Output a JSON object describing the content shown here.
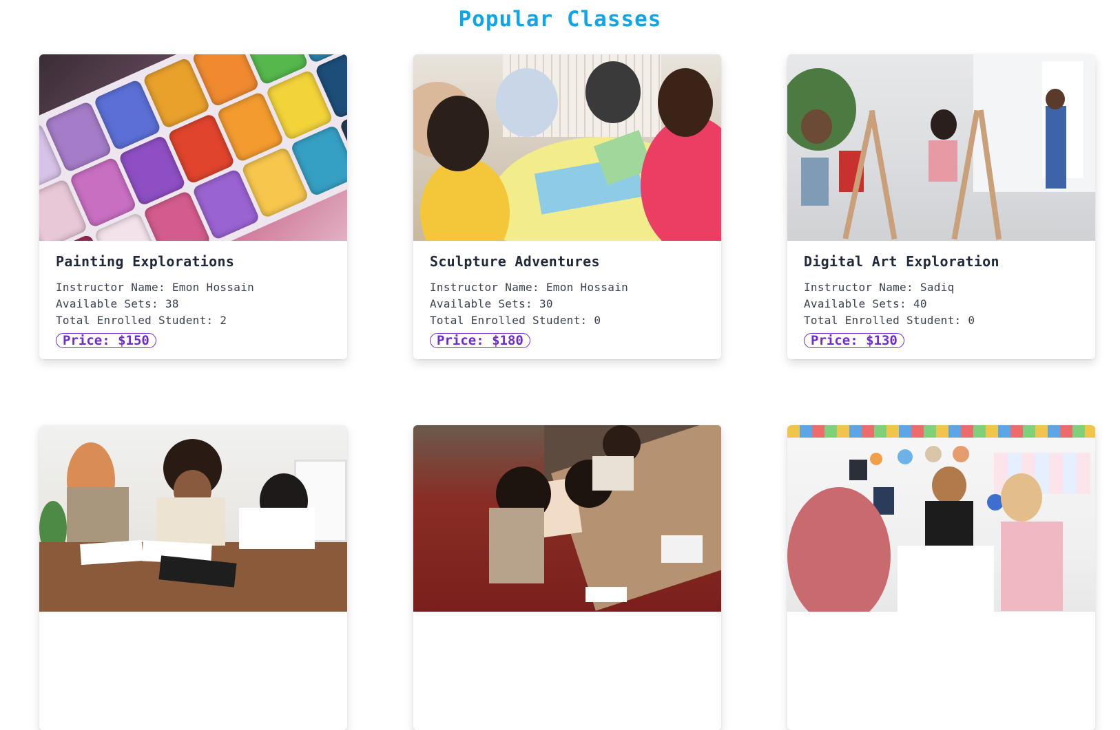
{
  "page": {
    "title": "Popular Classes"
  },
  "labels": {
    "instructor": "Instructor Name:",
    "sets": "Available Sets:",
    "enrolled": "Total Enrolled Student:",
    "price": "Price:"
  },
  "classes": [
    {
      "name": "Painting Explorations",
      "instructor": "Emon Hossain",
      "sets": "38",
      "enrolled": "2",
      "price": "$150",
      "image": "watercolor-palette-photo"
    },
    {
      "name": "Sculpture Adventures",
      "instructor": "Emon Hossain",
      "sets": "30",
      "enrolled": "0",
      "price": "$180",
      "image": "kids-crafting-table-photo"
    },
    {
      "name": "Digital Art Exploration",
      "instructor": "Sadiq",
      "sets": "40",
      "enrolled": "0",
      "price": "$130",
      "image": "easel-studio-class-photo"
    },
    {
      "name": "",
      "instructor": "",
      "sets": "",
      "enrolled": "",
      "price": "",
      "image": "kids-watercolor-painting-photo"
    },
    {
      "name": "",
      "instructor": "",
      "sets": "",
      "enrolled": "",
      "price": "",
      "image": "kids-drawing-workshop-photo"
    },
    {
      "name": "",
      "instructor": "",
      "sets": "",
      "enrolled": "",
      "price": "",
      "image": "classroom-kids-clay-photo"
    }
  ],
  "colors": {
    "title": "#0ea5e9",
    "price": "#6d28d9"
  }
}
